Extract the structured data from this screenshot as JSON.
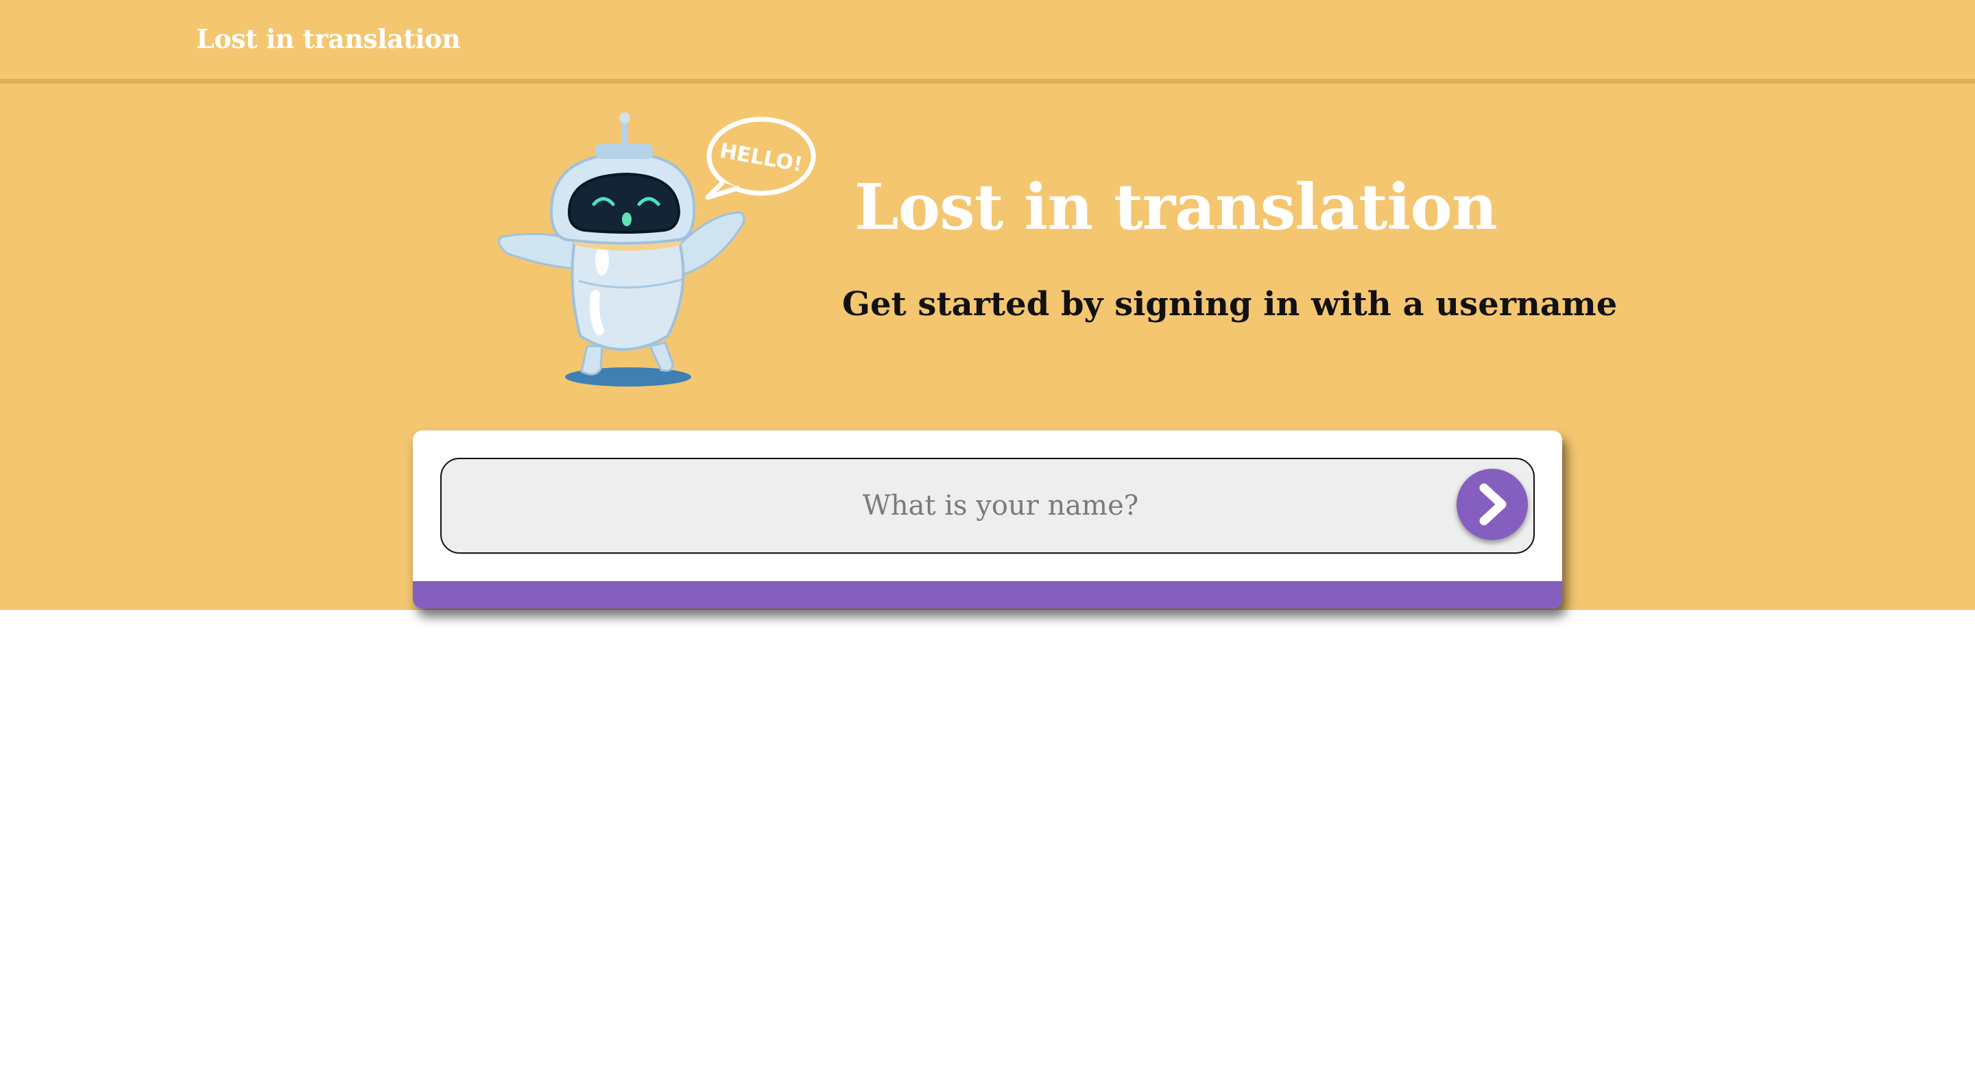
{
  "navbar": {
    "title": "Lost in translation"
  },
  "hero": {
    "title": "Lost in translation",
    "subtitle": "Get started by signing in with a username",
    "speech_bubble_text": "HELLO!"
  },
  "login": {
    "placeholder": "What is your name?",
    "value": "",
    "submit_icon": "chevron-right-icon"
  },
  "colors": {
    "background_accent": "#f4c670",
    "brand_purple": "#845fc0",
    "title_text": "#ffffff"
  }
}
